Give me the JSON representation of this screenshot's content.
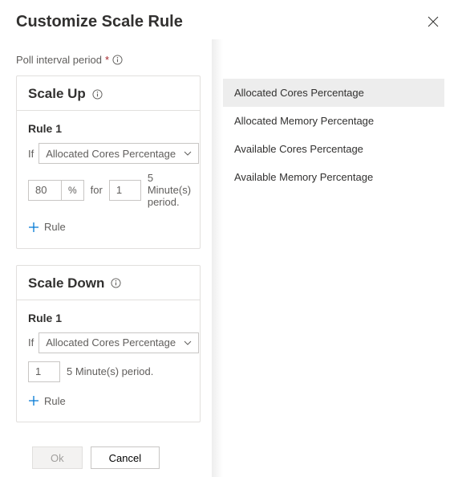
{
  "header": {
    "title": "Customize Scale Rule"
  },
  "poll": {
    "label": "Poll interval period",
    "required": "*"
  },
  "scaleUp": {
    "heading": "Scale Up",
    "rule_title": "Rule 1",
    "if_label": "If",
    "metric_selected": "Allocated Cores Percentage",
    "threshold_value": "80",
    "threshold_unit": "%",
    "for_label": "for",
    "duration_value": "1",
    "period_label": "5 Minute(s) period.",
    "add_label": "Rule"
  },
  "scaleDown": {
    "heading": "Scale Down",
    "rule_title": "Rule 1",
    "if_label": "If",
    "metric_selected": "Allocated Cores Percentage",
    "duration_value": "1",
    "period_label": "5 Minute(s) period.",
    "add_label": "Rule"
  },
  "footer": {
    "ok": "Ok",
    "cancel": "Cancel"
  },
  "dropdown": {
    "items": [
      "Allocated Cores Percentage",
      "Allocated Memory Percentage",
      "Available Cores Percentage",
      "Available Memory Percentage"
    ]
  }
}
